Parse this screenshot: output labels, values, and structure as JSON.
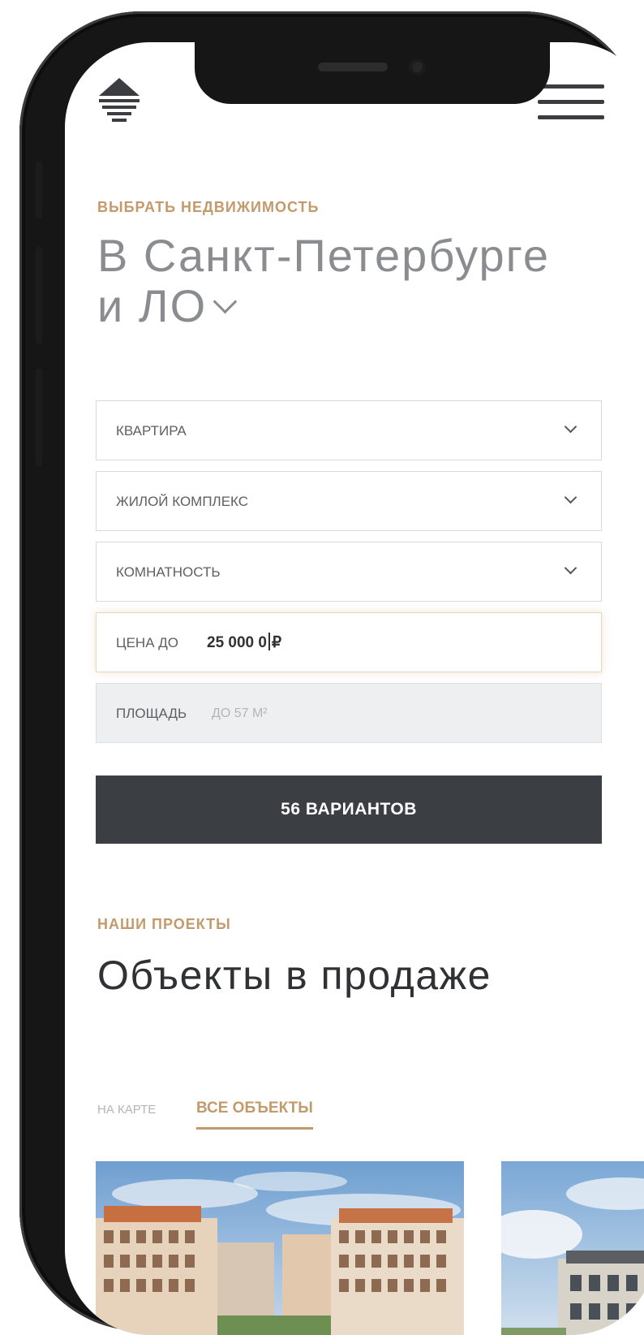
{
  "hero": {
    "eyebrow": "ВЫБРАТЬ НЕДВИЖИМОСТЬ",
    "title_line1": "В Санкт-Петербурге",
    "title_line2": "и ЛО"
  },
  "filters": {
    "type_label": "КВАРТИРА",
    "complex_label": "ЖИЛОЙ КОМПЛЕКС",
    "rooms_label": "КОМНАТНОСТЬ",
    "price_label": "ЦЕНА ДО",
    "price_value_before_cursor": "25 000 0",
    "price_value_after_cursor": "₽",
    "area_label": "ПЛОЩАДЬ",
    "area_placeholder": "ДО 57 М²"
  },
  "submit_label": "56 ВАРИАНТОВ",
  "projects": {
    "eyebrow": "НАШИ ПРОЕКТЫ",
    "title": "Объекты в продаже",
    "tabs": [
      {
        "label": "НА КАРТЕ",
        "active": false
      },
      {
        "label": "ВСЕ ОБЪЕКТЫ",
        "active": true
      }
    ]
  },
  "colors": {
    "accent": "#c29a6b",
    "dark": "#3b3e42",
    "title_grey": "#8a8c8f"
  },
  "icons": [
    "logo-icon",
    "menu-icon",
    "chevron-down-icon"
  ]
}
